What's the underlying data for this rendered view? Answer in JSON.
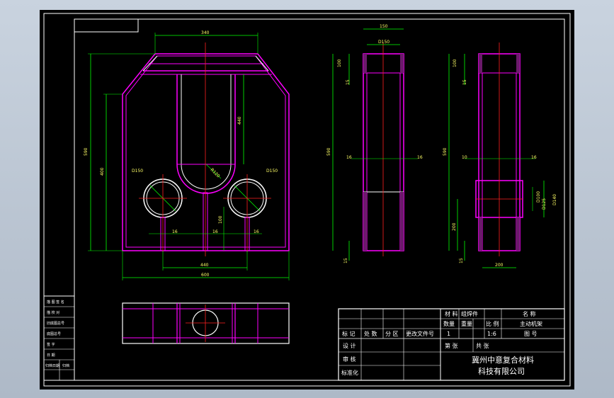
{
  "colors": {
    "background": "#000000",
    "frame": "#ffffff",
    "outline": "#ff00ff",
    "dimension": "#00ff00",
    "dimension_text": "#ffff66",
    "centerline": "#ff2020",
    "hole": "#ffffff"
  },
  "front_view": {
    "dims": {
      "top_width": "340",
      "overall_height": "590",
      "inner_height": "400",
      "slot_height": "440",
      "slot_radius": "R120",
      "hole_left": "D150",
      "hole_right": "D150",
      "pin_left": "16",
      "pin_mid": "16",
      "pin_right": "16",
      "pin_height": "100",
      "inner_width": "440",
      "bottom_width": "600"
    }
  },
  "side_view_1": {
    "dims": {
      "top_width": "150",
      "inner_width": "D150",
      "top_height_1": "100",
      "top_height_2": "15",
      "overall_height": "590",
      "wall_left": "16",
      "wall_right": "16",
      "bottom": "15"
    }
  },
  "side_view_2": {
    "dims": {
      "top_height_1": "100",
      "top_height_2": "15",
      "overall_height": "590",
      "wall_left": "10",
      "wall_right": "16",
      "bore_1": "D100",
      "bore_2": "D125",
      "bore_height": "D140",
      "lower_height": "200",
      "bottom": "15",
      "bottom_width": "200"
    }
  },
  "left_strip": [
    "描 图 签 名",
    "描 校 对",
    "旧底图总号",
    "底图总号",
    "签 字",
    "日 期",
    "归档日期",
    "归档"
  ],
  "title_block": {
    "header": {
      "material_label": "材 料",
      "material_value": "组焊件",
      "name_label": "名 称",
      "part_name": "主动机架"
    },
    "qty_label": "数量",
    "weight_label": "重量",
    "scale_label": "比 例",
    "drawing_no_label": "图 号",
    "qty_value": "1",
    "scale_value": "1:6",
    "revision_headers": [
      "标 记",
      "处 数",
      "分 区",
      "更改文件号"
    ],
    "sheet_label": "第 张",
    "total_label": "共 张",
    "design_label": "设 计",
    "review_label": "审 核",
    "standard_label": "标准化",
    "company_line1": "冀州中意复合材料",
    "company_line2": "科技有限公司"
  }
}
